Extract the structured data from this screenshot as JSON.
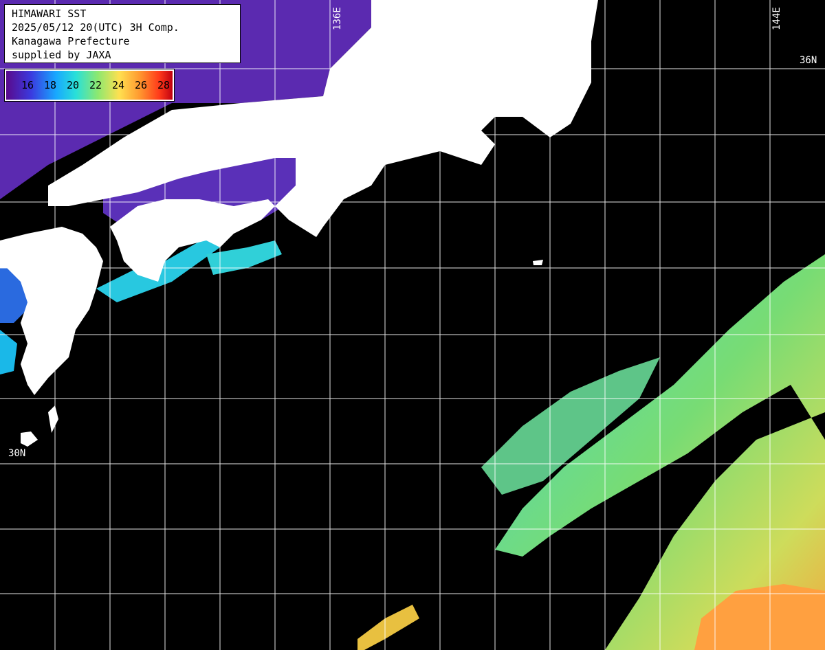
{
  "info": {
    "title": "HIMAWARI SST",
    "datetime": "2025/05/12 20(UTC) 3H Comp.",
    "region": "Kanagawa Prefecture",
    "credit": "supplied by JAXA"
  },
  "legend": {
    "labels": [
      "16",
      "18",
      "20",
      "22",
      "24",
      "26",
      "28"
    ],
    "gradient": [
      "#5a0a8c",
      "#3a3adf",
      "#18a8ff",
      "#29e0d8",
      "#8ce870",
      "#ffe050",
      "#ff9a30",
      "#ff3a1a",
      "#c00010"
    ]
  },
  "graticule": {
    "lat_labels": [
      "36N",
      "30N"
    ],
    "lon_labels": [
      "136E",
      "144E"
    ]
  },
  "colors": {
    "land": "#ffffff",
    "no_data": "#000000",
    "grid": "#ffffff",
    "cold_water": "#5b2aa8",
    "warm_water": "#ff9a3a"
  }
}
